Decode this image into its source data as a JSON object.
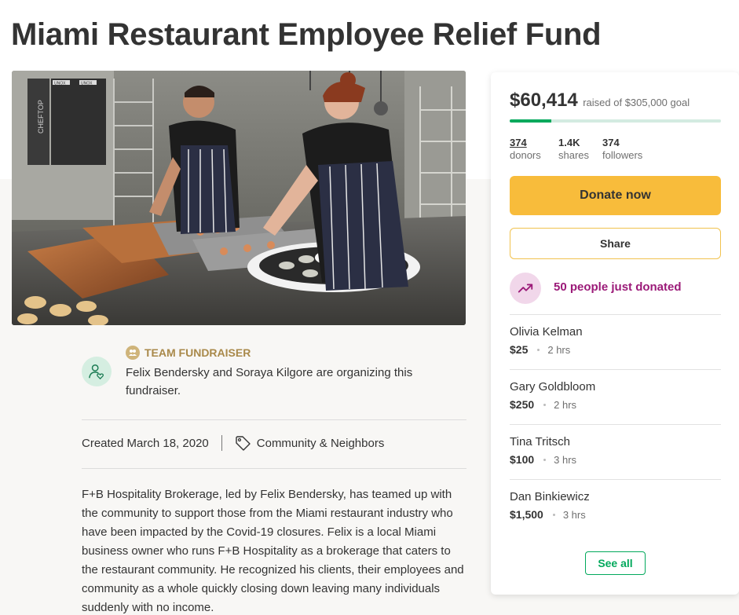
{
  "page": {
    "title": "Miami Restaurant Employee Relief Fund"
  },
  "organizer": {
    "team_label": "TEAM FUNDRAISER",
    "text": "Felix Bendersky and Soraya Kilgore are organizing this fundraiser.",
    "created": "Created March 18, 2020",
    "category": "Community & Neighbors"
  },
  "story": {
    "text": "F+B Hospitality Brokerage, led by Felix Bendersky, has teamed up with the community to support those from the Miami restaurant industry who have been impacted by the Covid-19 closures.  Felix is a local Miami business owner who runs F+B Hospitality as a brokerage that caters to the restaurant community. He recognized his clients, their employees and community as a whole quickly closing down leaving many individuals suddenly with no income."
  },
  "sidebar": {
    "raised_amount": "$60,414",
    "raised_goal": "raised of $305,000 goal",
    "progress_fraction": 0.198,
    "stats": [
      {
        "value": "374",
        "label": "donors"
      },
      {
        "value": "1.4K",
        "label": "shares"
      },
      {
        "value": "374",
        "label": "followers"
      }
    ],
    "donate_label": "Donate now",
    "share_label": "Share",
    "recent_label": "50 people just donated",
    "donations": [
      {
        "name": "Olivia Kelman",
        "amount": "$25",
        "time": "2 hrs"
      },
      {
        "name": "Gary Goldbloom",
        "amount": "$250",
        "time": "2 hrs"
      },
      {
        "name": "Tina Tritsch",
        "amount": "$100",
        "time": "3 hrs"
      },
      {
        "name": "Dan Binkiewicz",
        "amount": "$1,500",
        "time": "3 hrs"
      }
    ],
    "see_all_label": "See all"
  },
  "colors": {
    "accent_green": "#02a95c",
    "donate_yellow": "#f8bc3b",
    "trend_purple": "#9b1a78",
    "team_gold": "#a9894a"
  },
  "icons": {
    "organizer": "user-heart-icon",
    "team": "group-icon",
    "category": "tag-icon",
    "trend": "trending-up-icon"
  },
  "hero_image": {
    "oven_badge_left": "UNOX",
    "oven_badge_right": "UNOX",
    "oven_side_label": "CHEFTOP"
  }
}
